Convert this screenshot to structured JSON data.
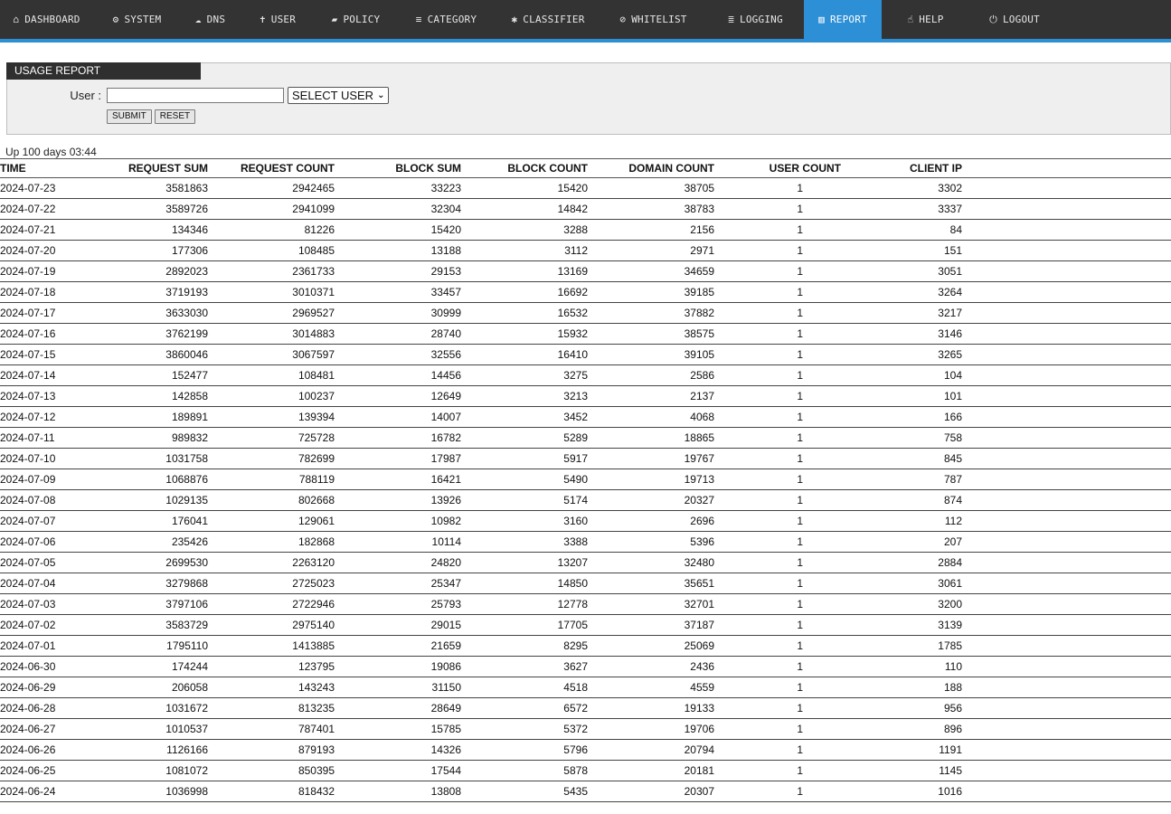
{
  "nav": [
    {
      "label": "DASHBOARD",
      "icon": "home-icon",
      "glyph": "⌂"
    },
    {
      "label": "SYSTEM",
      "icon": "gear-icon",
      "glyph": "⚙"
    },
    {
      "label": "DNS",
      "icon": "cloud-icon",
      "glyph": "☁"
    },
    {
      "label": "USER",
      "icon": "user-icon",
      "glyph": "✝"
    },
    {
      "label": "POLICY",
      "icon": "book-icon",
      "glyph": "▰"
    },
    {
      "label": "CATEGORY",
      "icon": "list-icon",
      "glyph": "≡"
    },
    {
      "label": "CLASSIFIER",
      "icon": "bug-icon",
      "glyph": "✱"
    },
    {
      "label": "WHITELIST",
      "icon": "check-circle-icon",
      "glyph": "⊘"
    },
    {
      "label": "LOGGING",
      "icon": "database-icon",
      "glyph": "≣"
    },
    {
      "label": "REPORT",
      "icon": "bar-chart-icon",
      "glyph": "▥",
      "active": true
    },
    {
      "label": "HELP",
      "icon": "hand-pointer-icon",
      "glyph": "☝"
    },
    {
      "label": "LOGOUT",
      "icon": "power-icon",
      "glyph": "⏻"
    }
  ],
  "panel": {
    "title": "USAGE REPORT",
    "user_label": "User :",
    "user_value": "",
    "select_value": "SELECT USER",
    "submit_label": "SUBMIT",
    "reset_label": "RESET"
  },
  "uptime": "Up 100 days 03:44",
  "table": {
    "headers": [
      "TIME",
      "REQUEST SUM",
      "REQUEST COUNT",
      "BLOCK SUM",
      "BLOCK COUNT",
      "DOMAIN COUNT",
      "USER COUNT",
      "CLIENT IP"
    ],
    "rows": [
      [
        "2024-07-23",
        "3581863",
        "2942465",
        "33223",
        "15420",
        "38705",
        "1",
        "3302"
      ],
      [
        "2024-07-22",
        "3589726",
        "2941099",
        "32304",
        "14842",
        "38783",
        "1",
        "3337"
      ],
      [
        "2024-07-21",
        "134346",
        "81226",
        "15420",
        "3288",
        "2156",
        "1",
        "84"
      ],
      [
        "2024-07-20",
        "177306",
        "108485",
        "13188",
        "3112",
        "2971",
        "1",
        "151"
      ],
      [
        "2024-07-19",
        "2892023",
        "2361733",
        "29153",
        "13169",
        "34659",
        "1",
        "3051"
      ],
      [
        "2024-07-18",
        "3719193",
        "3010371",
        "33457",
        "16692",
        "39185",
        "1",
        "3264"
      ],
      [
        "2024-07-17",
        "3633030",
        "2969527",
        "30999",
        "16532",
        "37882",
        "1",
        "3217"
      ],
      [
        "2024-07-16",
        "3762199",
        "3014883",
        "28740",
        "15932",
        "38575",
        "1",
        "3146"
      ],
      [
        "2024-07-15",
        "3860046",
        "3067597",
        "32556",
        "16410",
        "39105",
        "1",
        "3265"
      ],
      [
        "2024-07-14",
        "152477",
        "108481",
        "14456",
        "3275",
        "2586",
        "1",
        "104"
      ],
      [
        "2024-07-13",
        "142858",
        "100237",
        "12649",
        "3213",
        "2137",
        "1",
        "101"
      ],
      [
        "2024-07-12",
        "189891",
        "139394",
        "14007",
        "3452",
        "4068",
        "1",
        "166"
      ],
      [
        "2024-07-11",
        "989832",
        "725728",
        "16782",
        "5289",
        "18865",
        "1",
        "758"
      ],
      [
        "2024-07-10",
        "1031758",
        "782699",
        "17987",
        "5917",
        "19767",
        "1",
        "845"
      ],
      [
        "2024-07-09",
        "1068876",
        "788119",
        "16421",
        "5490",
        "19713",
        "1",
        "787"
      ],
      [
        "2024-07-08",
        "1029135",
        "802668",
        "13926",
        "5174",
        "20327",
        "1",
        "874"
      ],
      [
        "2024-07-07",
        "176041",
        "129061",
        "10982",
        "3160",
        "2696",
        "1",
        "112"
      ],
      [
        "2024-07-06",
        "235426",
        "182868",
        "10114",
        "3388",
        "5396",
        "1",
        "207"
      ],
      [
        "2024-07-05",
        "2699530",
        "2263120",
        "24820",
        "13207",
        "32480",
        "1",
        "2884"
      ],
      [
        "2024-07-04",
        "3279868",
        "2725023",
        "25347",
        "14850",
        "35651",
        "1",
        "3061"
      ],
      [
        "2024-07-03",
        "3797106",
        "2722946",
        "25793",
        "12778",
        "32701",
        "1",
        "3200"
      ],
      [
        "2024-07-02",
        "3583729",
        "2975140",
        "29015",
        "17705",
        "37187",
        "1",
        "3139"
      ],
      [
        "2024-07-01",
        "1795110",
        "1413885",
        "21659",
        "8295",
        "25069",
        "1",
        "1785"
      ],
      [
        "2024-06-30",
        "174244",
        "123795",
        "19086",
        "3627",
        "2436",
        "1",
        "110"
      ],
      [
        "2024-06-29",
        "206058",
        "143243",
        "31150",
        "4518",
        "4559",
        "1",
        "188"
      ],
      [
        "2024-06-28",
        "1031672",
        "813235",
        "28649",
        "6572",
        "19133",
        "1",
        "956"
      ],
      [
        "2024-06-27",
        "1010537",
        "787401",
        "15785",
        "5372",
        "19706",
        "1",
        "896"
      ],
      [
        "2024-06-26",
        "1126166",
        "879193",
        "14326",
        "5796",
        "20794",
        "1",
        "1191"
      ],
      [
        "2024-06-25",
        "1081072",
        "850395",
        "17544",
        "5878",
        "20181",
        "1",
        "1145"
      ],
      [
        "2024-06-24",
        "1036998",
        "818432",
        "13808",
        "5435",
        "20307",
        "1",
        "1016"
      ]
    ]
  }
}
